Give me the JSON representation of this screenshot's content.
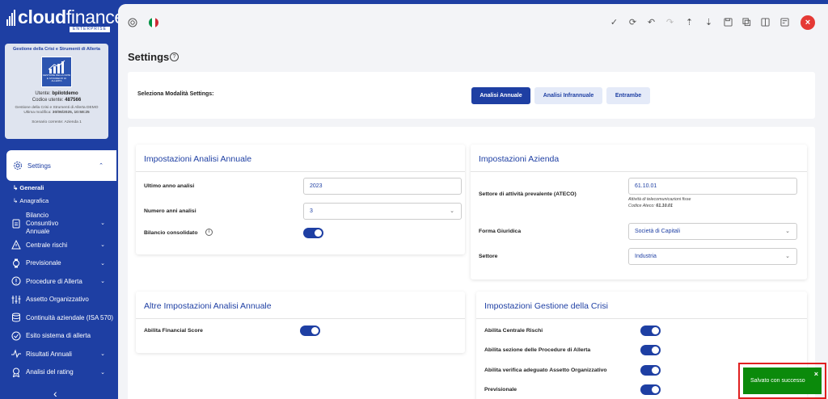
{
  "brand": {
    "name_bold": "cloud",
    "name_light": "finance",
    "edition": "ENTERPRISE"
  },
  "user_card": {
    "title": "Gestione della Crisi e Strumenti di Allerta",
    "image_caption": "GESTIONE DELLA CRISI E STRUMENTI DI ALLERTA",
    "user_label": "Utente:",
    "user": "bpilotdemo",
    "code_label": "Codice utente:",
    "code": "487566",
    "product": "Gestione della Crisi e Strumenti di Allerta DEMO",
    "last_edit_label": "Ultima modifica:",
    "last_edit": "30/06/2025, 10:58:25",
    "scenario": "Scenario corrente: Azienda 1"
  },
  "sidebar": {
    "settings": "Settings",
    "sub_items": [
      "Generali",
      "Anagrafica"
    ],
    "items": [
      {
        "label": "Bilancio Consuntivo Annuale",
        "icon": "document-icon",
        "chevron": true
      },
      {
        "label": "Centrale rischi",
        "icon": "warning-icon",
        "chevron": true
      },
      {
        "label": "Previsionale",
        "icon": "watch-icon",
        "chevron": true
      },
      {
        "label": "Procedure di Allerta",
        "icon": "alert-circle-icon",
        "chevron": true
      },
      {
        "label": "Assetto Organizzativo",
        "icon": "org-chart-icon",
        "chevron": false
      },
      {
        "label": "Continuità aziendale (ISA 570)",
        "icon": "database-icon",
        "chevron": false
      },
      {
        "label": "Esito sistema di allerta",
        "icon": "check-circle-icon",
        "chevron": false
      },
      {
        "label": "Risultati Annuali",
        "icon": "pulse-icon",
        "chevron": true
      },
      {
        "label": "Analisi del rating",
        "icon": "rating-icon",
        "chevron": true
      }
    ]
  },
  "page": {
    "title": "Settings"
  },
  "mode": {
    "label": "Seleziona Modalità Settings:",
    "buttons": [
      "Analisi Annuale",
      "Analisi Infrannuale",
      "Entrambe"
    ],
    "active": "Analisi Annuale"
  },
  "annual": {
    "title": "Impostazioni Analisi Annuale",
    "last_year_label": "Ultimo anno analisi",
    "last_year": "2023",
    "num_years_label": "Numero anni analisi",
    "num_years": "3",
    "consolidated_label": "Bilancio consolidato",
    "consolidated": true
  },
  "company": {
    "title": "Impostazioni Azienda",
    "ateco_label": "Settore di attività prevalente (ATECO)",
    "ateco": "61.10.01",
    "ateco_desc": "Attività di telecomunicazioni fisse",
    "ateco_code_label": "Codice Ateco:",
    "ateco_code": "61.10.01",
    "legal_form_label": "Forma Giuridica",
    "legal_form": "Società di Capitali",
    "sector_label": "Settore",
    "sector": "Industria"
  },
  "other_annual": {
    "title": "Altre Impostazioni Analisi Annuale",
    "financial_score_label": "Abilita Financial Score",
    "financial_score": true
  },
  "crisis": {
    "title": "Impostazioni Gestione della Crisi",
    "toggles": [
      {
        "label": "Abilita Centrale Rischi",
        "on": true
      },
      {
        "label": "Abilita sezione delle Procedure di Allerta",
        "on": true
      },
      {
        "label": "Abilita verifica adeguato Assetto Organizzativo",
        "on": true
      },
      {
        "label": "Previsionale",
        "on": true
      }
    ]
  },
  "toast": {
    "message": "Salvato con successo",
    "close": "×",
    "color": "#0b8a0b"
  },
  "colors": {
    "primary": "#1e3fa3",
    "close": "#e53935"
  }
}
